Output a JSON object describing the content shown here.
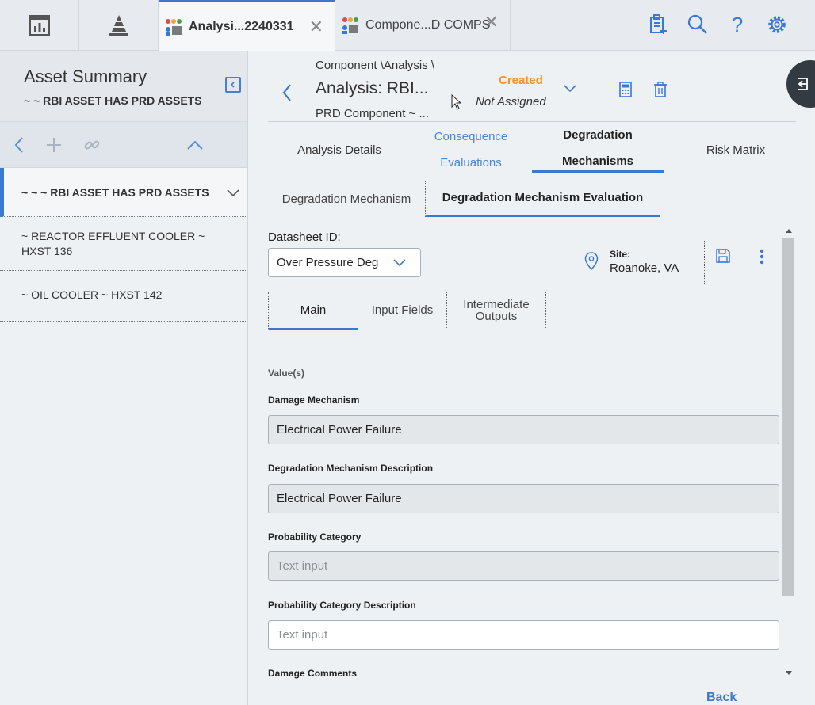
{
  "top_tabs": [
    {
      "label": "Analysi...2240331",
      "active": true
    },
    {
      "label": "Compone...D COMPS",
      "active": false
    }
  ],
  "top_icons": [
    "clipboard-add-icon",
    "search-icon",
    "help-icon",
    "gear-icon"
  ],
  "left_pane": {
    "title": "Asset Summary",
    "subtitle": "~ ~ RBI ASSET HAS PRD ASSETS",
    "assets": [
      {
        "label": "~ ~ ~ RBI ASSET HAS PRD ASSETS",
        "selected": true
      },
      {
        "label": "~ REACTOR EFFLUENT COOLER ~ HXST 136",
        "selected": false
      },
      {
        "label": "~ OIL COOLER ~ HXST 142",
        "selected": false
      }
    ]
  },
  "header": {
    "breadcrumb": "Component \\Analysis \\",
    "title": "Analysis: RBI...",
    "subtitle": "PRD Component ~ ...",
    "status": "Created",
    "assignment": "Not Assigned",
    "status_color": "#f0962a"
  },
  "main_tabs": [
    {
      "line1": "Analysis Details",
      "line2": "",
      "active": false
    },
    {
      "line1": "Consequence",
      "line2": "Evaluations",
      "active": false
    },
    {
      "line1": "Degradation",
      "line2": "Mechanisms",
      "active": true
    },
    {
      "line1": "Risk Matrix",
      "line2": "",
      "active": false
    }
  ],
  "sub_tabs": [
    {
      "label": "Degradation Mechanism",
      "active": false
    },
    {
      "label": "Degradation Mechanism Evaluation",
      "active": true
    }
  ],
  "datasheet": {
    "label": "Datasheet ID:",
    "value": "Over Pressure Deg",
    "site_label": "Site:",
    "site_value": "Roanoke, VA"
  },
  "form_tabs": [
    {
      "label": "Main",
      "active": true
    },
    {
      "label": "Input Fields",
      "active": false
    },
    {
      "line1": "Intermediate",
      "line2": "Outputs",
      "active": false
    }
  ],
  "form": {
    "section_label": "Value(s)",
    "fields": [
      {
        "label": "Damage Mechanism",
        "value": "Electrical Power Failure",
        "placeholder": "",
        "editable": false
      },
      {
        "label": "Degradation Mechanism Description",
        "value": "Electrical Power Failure",
        "placeholder": "",
        "editable": false
      },
      {
        "label": "Probability Category",
        "value": "",
        "placeholder": "Text input",
        "editable": false
      },
      {
        "label": "Probability Category Description",
        "value": "",
        "placeholder": "Text input",
        "editable": true
      }
    ],
    "last_label": "Damage Comments"
  },
  "back_label": "Back",
  "accent_color": "#3b78d1"
}
